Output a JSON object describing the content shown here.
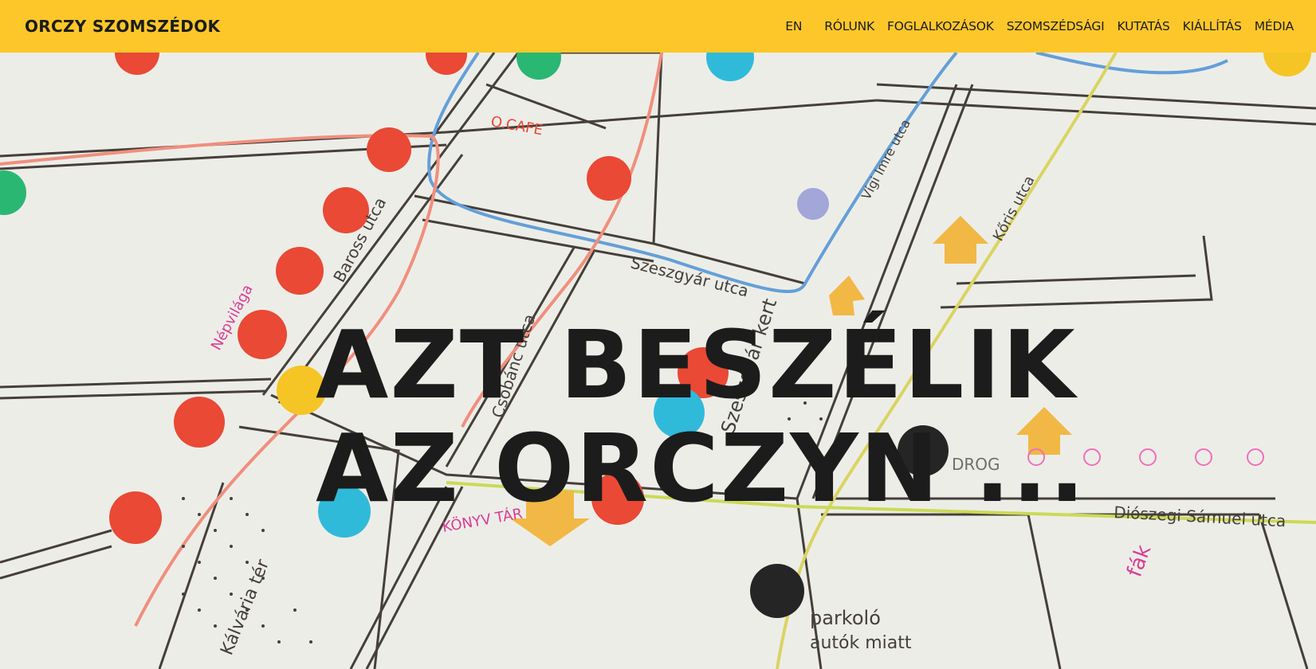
{
  "header": {
    "logo": "ORCZY SZOMSZÉDOK",
    "lang": "EN",
    "nav": [
      "RÓLUNK",
      "FOGLALKOZÁSOK",
      "SZOMSZÉDSÁGI",
      "KUTATÁS",
      "KIÁLLÍTÁS",
      "MÉDIA"
    ]
  },
  "hero": {
    "headline_line1": "AZT BESZÉLIK",
    "headline_line2": "AZ ORCZYN ...",
    "map_labels": {
      "baross": "Baross utca",
      "szeszgyar": "Szeszgyár utca",
      "csobanc": "Csobánc utca",
      "szeszgyar_kert": "Szeszgyár kert",
      "vig_imre": "Vígi Imre utca",
      "koris": "Kőris utca",
      "kalvaria": "Kálvária tér",
      "dioszegi": "Diószegi Sámuel utca",
      "drog": "DROG",
      "parkolo": "parkoló",
      "autok": "autók miatt",
      "kony": "KÖNYV TÁR",
      "ocafe": "O.CAFE",
      "fak": "fák",
      "nepvilaga": "Népvilága"
    }
  },
  "colors": {
    "accent": "#fdc72a",
    "text": "#1c1c1c",
    "dot_red": "#e8402b",
    "dot_blue": "#25b7d8",
    "dot_green": "#1fb46b",
    "dot_black": "#1a1a1a",
    "dot_yellow": "#f5c21a"
  }
}
